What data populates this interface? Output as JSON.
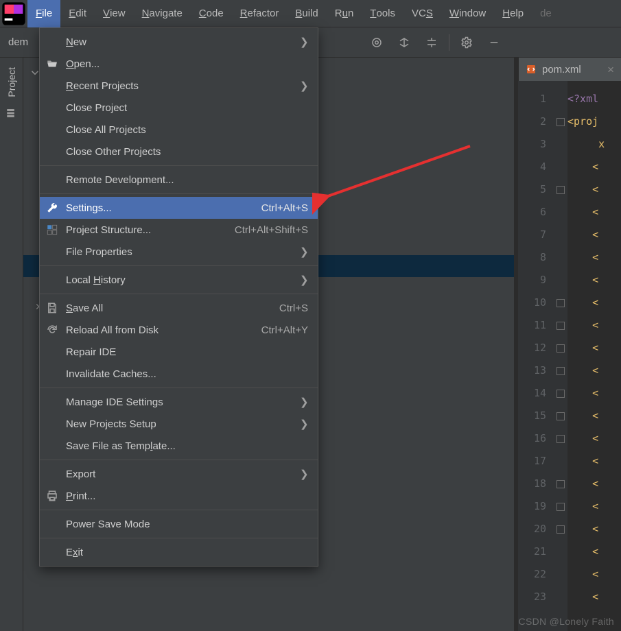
{
  "menubar": {
    "items": [
      {
        "label": "File",
        "mnemonic": "F",
        "active": true
      },
      {
        "label": "Edit",
        "mnemonic": "E"
      },
      {
        "label": "View",
        "mnemonic": "V"
      },
      {
        "label": "Navigate",
        "mnemonic": "N"
      },
      {
        "label": "Code",
        "mnemonic": "C"
      },
      {
        "label": "Refactor",
        "mnemonic": "R"
      },
      {
        "label": "Build",
        "mnemonic": "B"
      },
      {
        "label": "Run",
        "mnemonic": "u",
        "pre": "R"
      },
      {
        "label": "Tools",
        "mnemonic": "T"
      },
      {
        "label": "VCS",
        "mnemonic": "S",
        "pre": "VC"
      },
      {
        "label": "Window",
        "mnemonic": "W"
      },
      {
        "label": "Help",
        "mnemonic": "H"
      }
    ],
    "trailing": "de"
  },
  "breadcrumb": {
    "root": "dem"
  },
  "sidebar": {
    "project_label": "Project"
  },
  "toolbar": {
    "icons": [
      "globe",
      "expand-all",
      "collapse-all",
      "sep",
      "gear",
      "minimize"
    ]
  },
  "editor": {
    "tab_filename": "pom.xml",
    "lines": [
      1,
      2,
      3,
      4,
      5,
      6,
      7,
      8,
      9,
      10,
      11,
      12,
      13,
      14,
      15,
      16,
      17,
      18,
      19,
      20,
      21,
      22,
      23
    ],
    "code_l1": "<?xml",
    "code_l2": "<proj",
    "code_l3": "     x",
    "brace": "<"
  },
  "file_menu": {
    "groups": [
      [
        {
          "label": "New",
          "mnemonic": "N",
          "submenu": true,
          "icon": null
        },
        {
          "label": "Open...",
          "mnemonic": "O",
          "icon": "open"
        },
        {
          "label": "Recent Projects",
          "mnemonic": "R",
          "submenu": true
        },
        {
          "label": "Close Project"
        },
        {
          "label": "Close All Projects"
        },
        {
          "label": "Close Other Projects"
        }
      ],
      [
        {
          "label": "Remote Development..."
        }
      ],
      [
        {
          "label": "Settings...",
          "icon": "wrench",
          "shortcut": "Ctrl+Alt+S",
          "highlight": true
        },
        {
          "label": "Project Structure...",
          "icon": "structure",
          "shortcut": "Ctrl+Alt+Shift+S"
        },
        {
          "label": "File Properties",
          "submenu": true
        }
      ],
      [
        {
          "label": "Local History",
          "mnemonic": "H",
          "pre": "Local ",
          "submenu": true
        }
      ],
      [
        {
          "label": "Save All",
          "mnemonic": "S",
          "icon": "save",
          "shortcut": "Ctrl+S"
        },
        {
          "label": "Reload All from Disk",
          "icon": "reload",
          "shortcut": "Ctrl+Alt+Y"
        },
        {
          "label": "Repair IDE"
        },
        {
          "label": "Invalidate Caches..."
        }
      ],
      [
        {
          "label": "Manage IDE Settings",
          "submenu": true
        },
        {
          "label": "New Projects Setup",
          "submenu": true
        },
        {
          "label": "Save File as Template...",
          "mnemonic": "l",
          "pre": "Save File as Temp",
          "post": "ate..."
        }
      ],
      [
        {
          "label": "Export",
          "submenu": true
        },
        {
          "label": "Print...",
          "mnemonic": "P",
          "icon": "print"
        }
      ],
      [
        {
          "label": "Power Save Mode"
        }
      ],
      [
        {
          "label": "Exit",
          "mnemonic": "x",
          "pre": "E",
          "post": "it"
        }
      ]
    ]
  },
  "watermark": "CSDN @Lonely Faith"
}
